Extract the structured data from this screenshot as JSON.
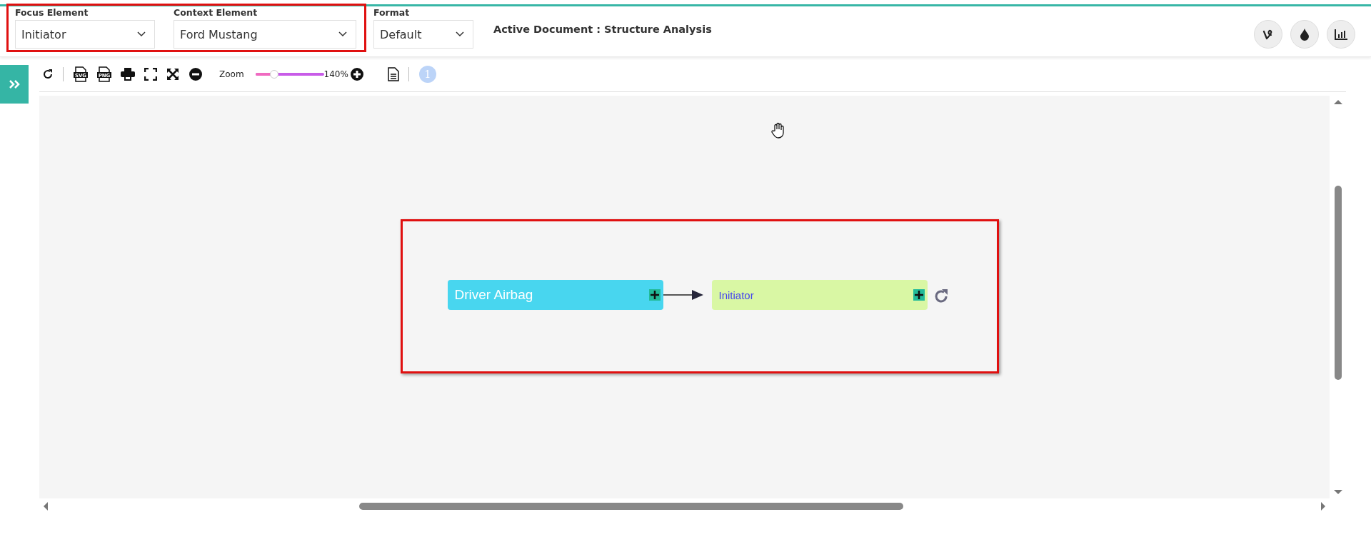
{
  "header": {
    "highlighted": true,
    "selectors": [
      {
        "label": "Focus Element",
        "value": "Initiator"
      },
      {
        "label": "Context Element",
        "value": "Ford Mustang"
      },
      {
        "label": "Format",
        "value": "Default"
      }
    ],
    "active_document": "Active Document : Structure Analysis"
  },
  "toolbar": {
    "export_formats": [
      "SVG",
      "PNG"
    ],
    "zoom_label": "Zoom",
    "zoom": {
      "level": 0.28
    },
    "zoom_reading": "140%",
    "badge": "1"
  },
  "diagram": {
    "highlighted": true,
    "nodes": [
      {
        "label": "Driver Airbag",
        "color": "#48d6ef"
      },
      {
        "label": "Initiator",
        "color": "#d9f7a4"
      }
    ]
  }
}
